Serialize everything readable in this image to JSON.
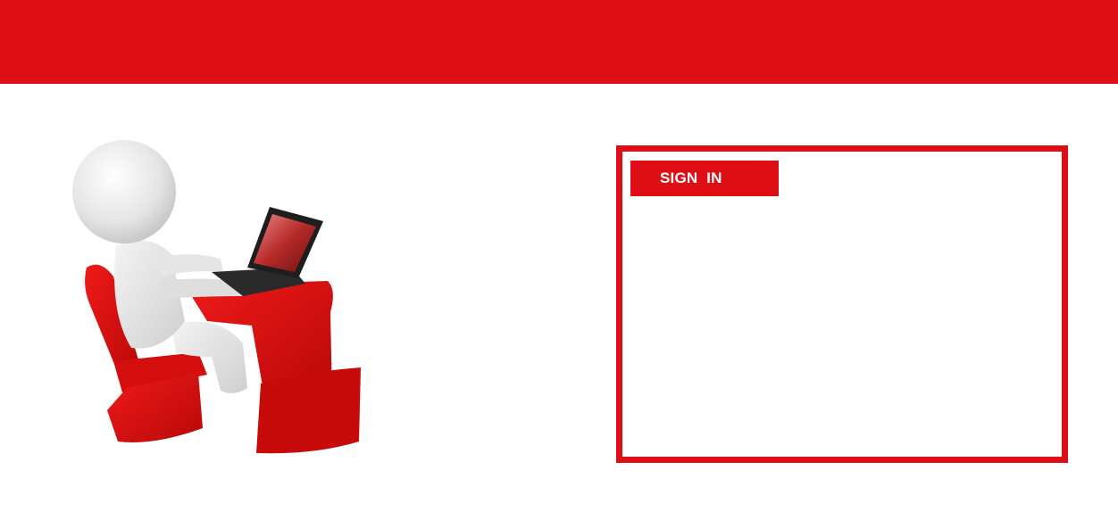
{
  "header": {
    "color": "#dd0e16"
  },
  "illustration": {
    "icon": "person-at-laptop-illustration",
    "accent_color": "#dd0e16"
  },
  "signin": {
    "tab_label": "SIGN  IN",
    "border_color": "#dd0e16"
  }
}
